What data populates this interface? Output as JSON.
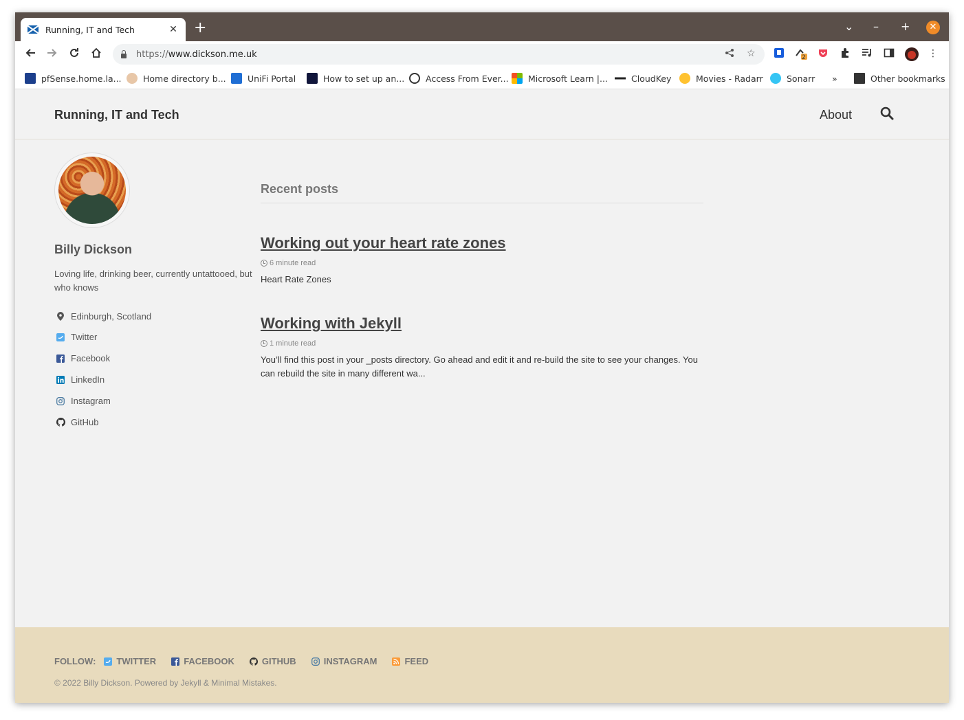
{
  "browser": {
    "tab": {
      "title": "Running, IT and Tech",
      "close": "✕"
    },
    "new_tab": "+",
    "window_controls": {
      "dropdown": "⌄",
      "minimize": "–",
      "maximize": "+",
      "close": "✕"
    },
    "url": {
      "scheme": "https://",
      "host": "www.dickson.me.uk"
    },
    "extension_badge": "2"
  },
  "bookmarks": {
    "items": [
      {
        "label": "pfSense.home.la...",
        "icon": "pfsense-icon"
      },
      {
        "label": "Home directory b...",
        "icon": "face-icon"
      },
      {
        "label": "UniFi Portal",
        "icon": "unifi-icon"
      },
      {
        "label": "How to set up an...",
        "icon": "triangle-icon"
      },
      {
        "label": "Access From Ever...",
        "icon": "swirl-icon"
      },
      {
        "label": "Microsoft Learn |...",
        "icon": "microsoft-icon"
      },
      {
        "label": "CloudKey",
        "icon": "cloudkey-icon"
      },
      {
        "label": "Movies - Radarr",
        "icon": "radarr-icon"
      },
      {
        "label": "Sonarr",
        "icon": "sonarr-icon"
      }
    ],
    "overflow": "»",
    "other": "Other bookmarks"
  },
  "site": {
    "title": "Running, IT and Tech",
    "nav": {
      "about": "About"
    }
  },
  "author": {
    "name": "Billy Dickson",
    "bio": "Loving life, drinking beer, currently untattooed, but who knows",
    "location": "Edinburgh, Scotland",
    "links": [
      {
        "label": "Twitter",
        "icon": "twitter-icon",
        "color": "#55acee"
      },
      {
        "label": "Facebook",
        "icon": "facebook-icon",
        "color": "#3b5998"
      },
      {
        "label": "LinkedIn",
        "icon": "linkedin-icon",
        "color": "#007bb6"
      },
      {
        "label": "Instagram",
        "icon": "instagram-icon",
        "color": "#517fa4"
      },
      {
        "label": "GitHub",
        "icon": "github-icon",
        "color": "#333333"
      }
    ]
  },
  "main": {
    "heading": "Recent posts",
    "posts": [
      {
        "title": "Working out your heart rate zones",
        "read_time": "6 minute read",
        "excerpt": "Heart Rate Zones"
      },
      {
        "title": "Working with Jekyll",
        "read_time": "1 minute read",
        "excerpt": "You’ll find this post in your _posts directory. Go ahead and edit it and re-build the site to see your changes. You can rebuild the site in many different wa..."
      }
    ]
  },
  "footer": {
    "follow_label": "FOLLOW:",
    "links": [
      {
        "label": "TWITTER",
        "icon": "twitter-icon",
        "color": "#55acee"
      },
      {
        "label": "FACEBOOK",
        "icon": "facebook-icon",
        "color": "#3b5998"
      },
      {
        "label": "GITHUB",
        "icon": "github-icon",
        "color": "#333333"
      },
      {
        "label": "INSTAGRAM",
        "icon": "instagram-icon",
        "color": "#517fa4"
      },
      {
        "label": "FEED",
        "icon": "rss-icon",
        "color": "#fa9b39"
      }
    ],
    "copyright": "© 2022 Billy Dickson. Powered by Jekyll & Minimal Mistakes."
  },
  "colors": {
    "chrome_frame": "#5a4f49",
    "page_bg": "#f2f2f2",
    "footer_bg": "#e8dbbd",
    "window_close": "#f08b28"
  }
}
